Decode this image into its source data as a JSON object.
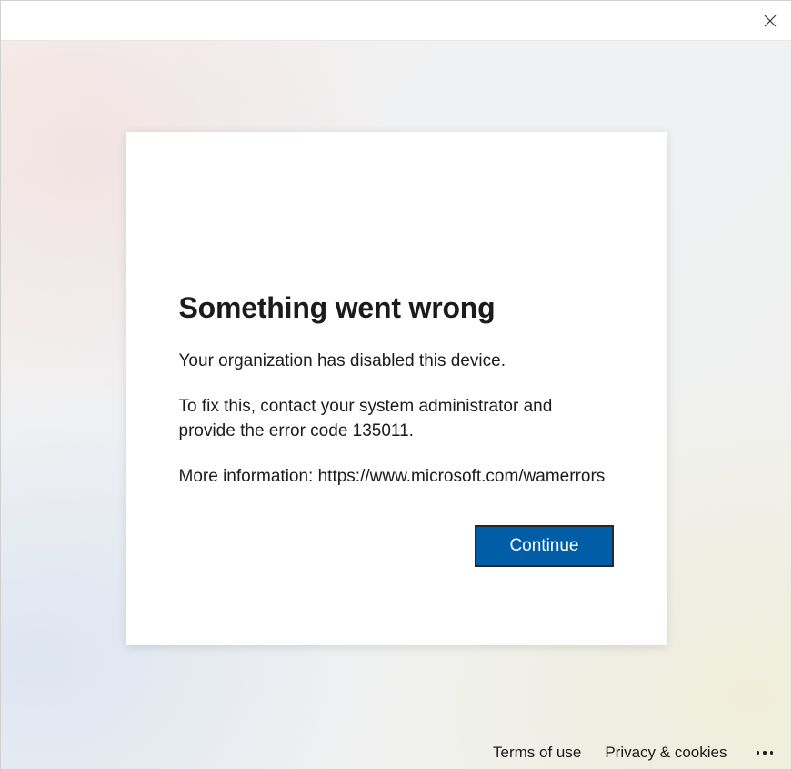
{
  "dialog": {
    "title": "Something went wrong",
    "line1": "Your organization has disabled this device.",
    "line2": "To fix this, contact your system administrator and provide the error code 135011.",
    "line3": "More information: https://www.microsoft.com/wamerrors",
    "continue_label": "Continue"
  },
  "footer": {
    "terms": "Terms of use",
    "privacy": "Privacy & cookies"
  }
}
